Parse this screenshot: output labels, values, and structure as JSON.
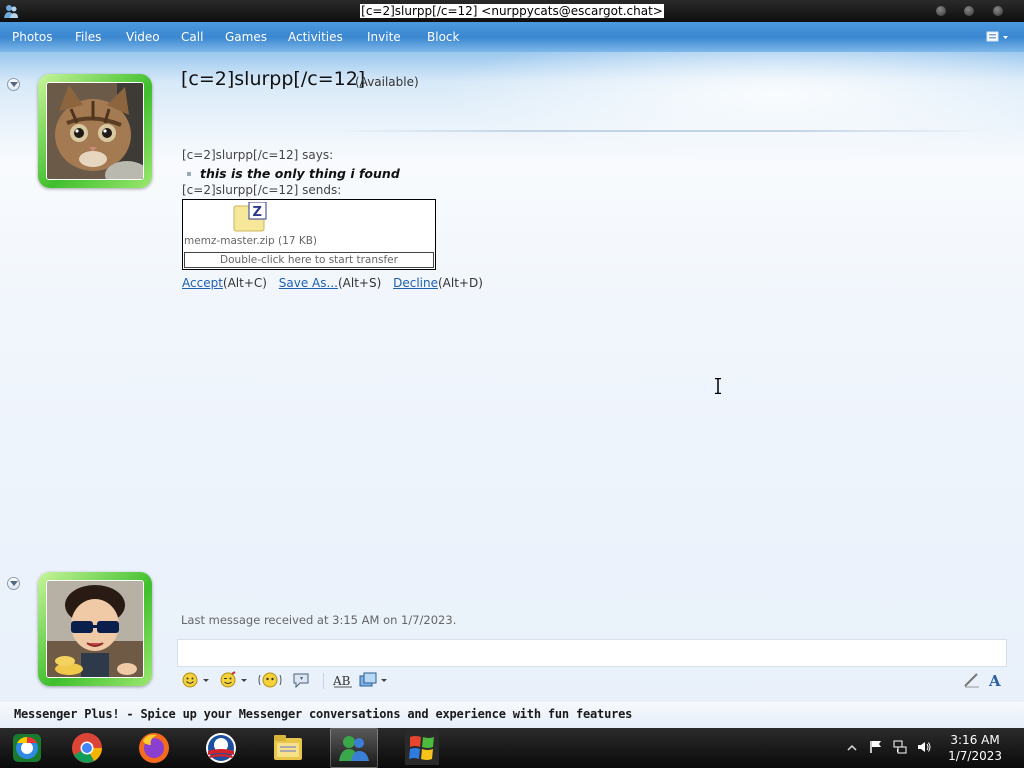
{
  "window": {
    "title": "[c=2]slurpp[/c=12] <nurppycats@escargot.chat>"
  },
  "menu": {
    "items": [
      "Photos",
      "Files",
      "Video",
      "Call",
      "Games",
      "Activities",
      "Invite",
      "Block"
    ]
  },
  "conversation": {
    "contact_name": "[c=2]slurpp[/c=12]",
    "contact_status": "(Available)",
    "says_label": "[c=2]slurpp[/c=12] says:",
    "message": "this is the only thing i found",
    "sends_label": "[c=2]slurpp[/c=12] sends:",
    "transfer": {
      "file_info": "memz-master.zip (17 KB)",
      "start_hint": "Double-click here to start transfer"
    },
    "actions": {
      "accept_label": "Accept",
      "accept_shortcut": "(Alt+C)",
      "save_label": "Save As...",
      "save_shortcut": "(Alt+S)",
      "decline_label": "Decline",
      "decline_shortcut": "(Alt+D)"
    },
    "last_message": "Last message received at 3:15 AM on 1/7/2023."
  },
  "plus_bar": {
    "text": "Messenger Plus! - Spice up your Messenger conversations and experience with fun features"
  },
  "taskbar": {
    "time": "3:16 AM",
    "date": "1/7/2023"
  },
  "colors": {
    "menu_blue": "#3a86cf",
    "avatar_green": "#3fbf2d",
    "link_blue": "#1d5fb0"
  }
}
